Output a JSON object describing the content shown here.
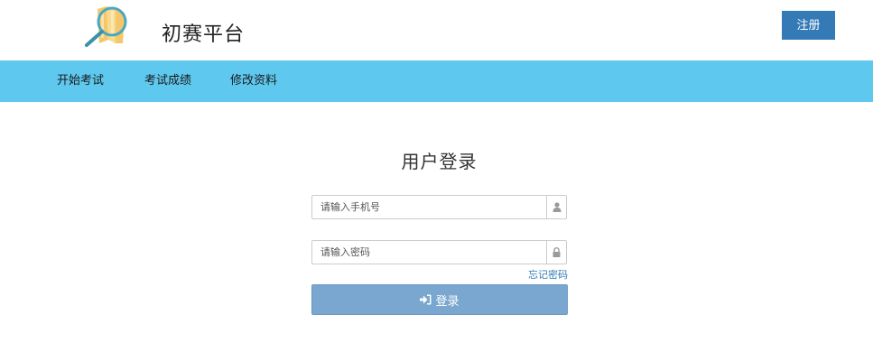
{
  "header": {
    "logo_icon": "magnifier-books-logo",
    "title": "初赛平台",
    "register_label": "注册",
    "register_color": "#337ab7"
  },
  "nav": {
    "background": "#5ec8ee",
    "items": [
      {
        "label": "开始考试"
      },
      {
        "label": "考试成绩"
      },
      {
        "label": "修改资料"
      }
    ]
  },
  "login": {
    "title": "用户登录",
    "phone": {
      "placeholder": "请输入手机号",
      "value": "",
      "icon": "user-icon"
    },
    "password": {
      "placeholder": "请输入密码",
      "value": "",
      "icon": "lock-icon"
    },
    "forgot_label": "忘记密码",
    "submit_label": "登录",
    "submit_icon": "sign-in-icon"
  }
}
